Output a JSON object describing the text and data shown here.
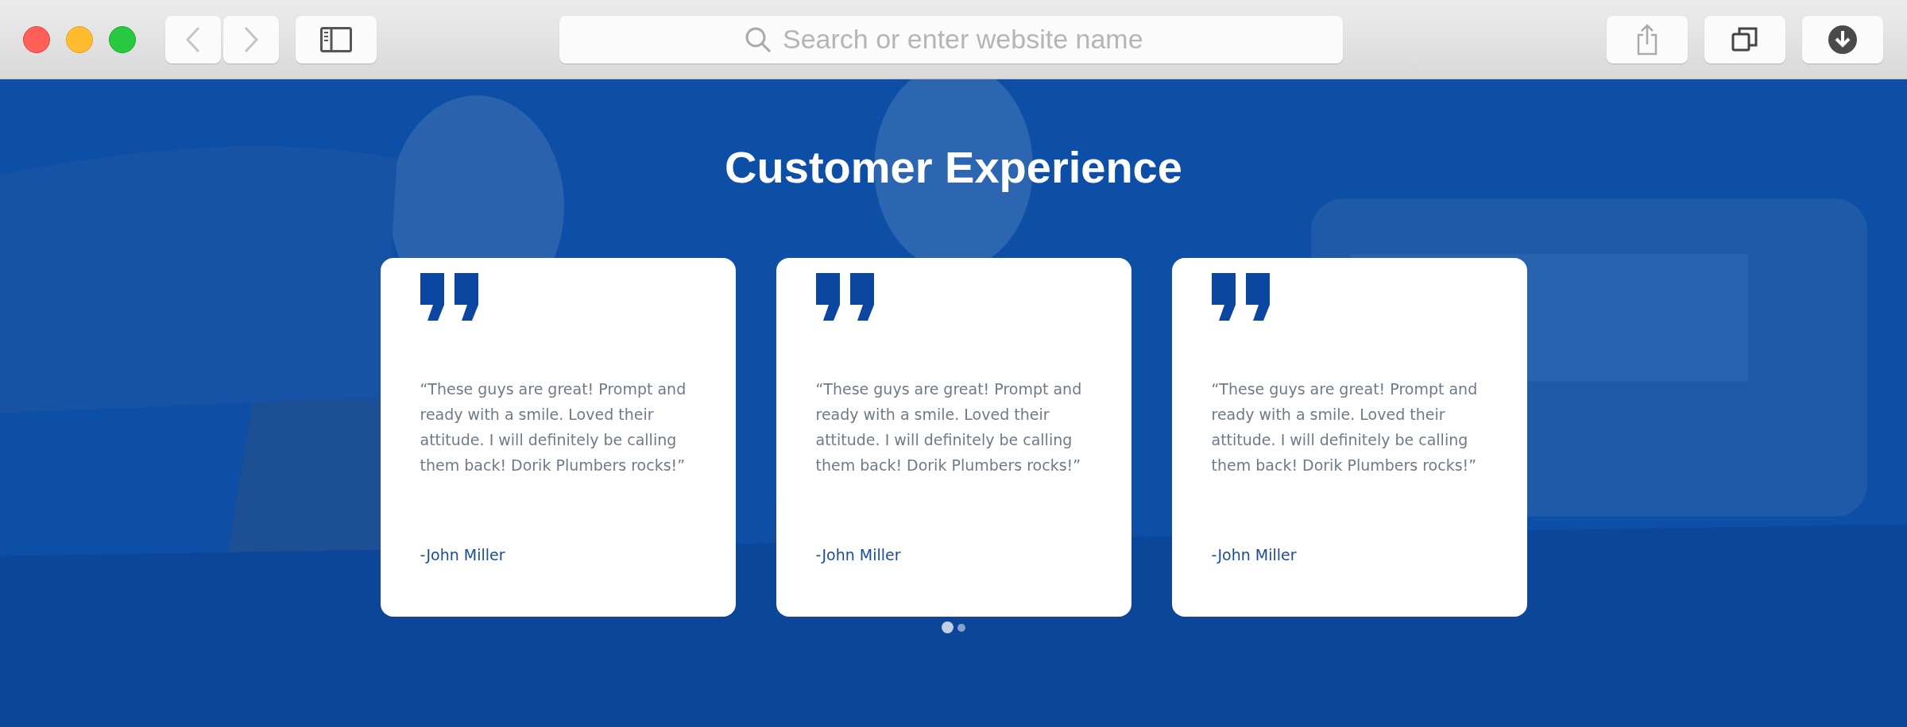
{
  "browser": {
    "search": {
      "placeholder": "Search or enter website name"
    }
  },
  "section": {
    "title": "Customer Experience",
    "testimonials": [
      {
        "quote": "“These guys are great! Prompt and ready with a smile. Loved their attitude. I will definitely be calling them back! Dorik Plumbers rocks!”",
        "author": "-John Miller"
      },
      {
        "quote": "“These guys are great! Prompt and ready with a smile. Loved their attitude. I will definitely be calling them back! Dorik Plumbers rocks!”",
        "author": "-John Miller"
      },
      {
        "quote": "“These guys are great! Prompt and ready with a smile. Loved their attitude. I will definitely be calling them back! Dorik Plumbers rocks!”",
        "author": "-John Miller"
      }
    ],
    "dots": [
      {
        "selected": true
      },
      {
        "selected": false
      }
    ]
  }
}
